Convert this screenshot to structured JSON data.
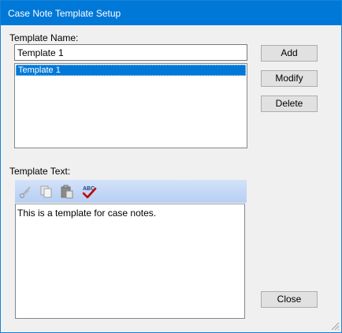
{
  "window": {
    "title": "Case Note Template Setup"
  },
  "form": {
    "template_name_label": "Template Name:",
    "template_name_value": "Template 1",
    "templates": [
      "Template 1"
    ],
    "template_text_label": "Template Text:",
    "template_text_value": "This is a template for case notes."
  },
  "buttons": {
    "add": "Add",
    "modify": "Modify",
    "delete": "Delete",
    "close": "Close"
  },
  "toolbar": {
    "icons": [
      "cut-icon",
      "copy-icon",
      "paste-icon",
      "spell-check-icon"
    ],
    "spell_check_text": "ABC"
  },
  "colors": {
    "titlebar": "#0078d7",
    "selection": "#0078d7",
    "toolbar_gradient_top": "#d3e2f9",
    "toolbar_gradient_bottom": "#b7cff3",
    "spell_check": "#c00000"
  }
}
